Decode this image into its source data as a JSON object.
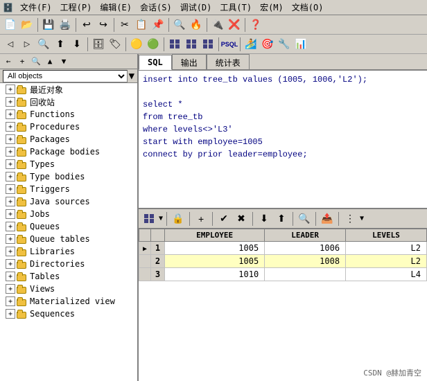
{
  "menubar": {
    "items": [
      {
        "label": "文件(F)"
      },
      {
        "label": "工程(P)"
      },
      {
        "label": "编辑(E)"
      },
      {
        "label": "会话(S)"
      },
      {
        "label": "调试(D)"
      },
      {
        "label": "工具(T)"
      },
      {
        "label": "宏(M)"
      },
      {
        "label": "文档(O)"
      }
    ]
  },
  "left_panel": {
    "nav_items": [
      "←",
      "+",
      "🔍",
      "⬆",
      "⬇"
    ],
    "dropdown_label": "All objects",
    "tree": [
      {
        "label": "最近对象",
        "expanded": false
      },
      {
        "label": "回收站",
        "expanded": false
      },
      {
        "label": "Functions",
        "expanded": false
      },
      {
        "label": "Procedures",
        "expanded": false
      },
      {
        "label": "Packages",
        "expanded": false
      },
      {
        "label": "Package bodies",
        "expanded": false
      },
      {
        "label": "Types",
        "expanded": false
      },
      {
        "label": "Type bodies",
        "expanded": false
      },
      {
        "label": "Triggers",
        "expanded": false
      },
      {
        "label": "Java sources",
        "expanded": false
      },
      {
        "label": "Jobs",
        "expanded": false
      },
      {
        "label": "Queues",
        "expanded": false
      },
      {
        "label": "Queue tables",
        "expanded": false
      },
      {
        "label": "Libraries",
        "expanded": false
      },
      {
        "label": "Directories",
        "expanded": false
      },
      {
        "label": "Tables",
        "expanded": false
      },
      {
        "label": "Views",
        "expanded": false
      },
      {
        "label": "Materialized view",
        "expanded": false
      },
      {
        "label": "Sequences",
        "expanded": false
      }
    ]
  },
  "sql_tabs": [
    {
      "label": "SQL",
      "active": true
    },
    {
      "label": "输出",
      "active": false
    },
    {
      "label": "统计表",
      "active": false
    }
  ],
  "sql_content": {
    "lines": [
      "insert into tree_tb values (1005, 1006,'L2');",
      "",
      "select *",
      "from tree_tb",
      "where levels<>'L3'",
      "start with employee=1005",
      "connect by prior leader=employee;"
    ]
  },
  "data_grid": {
    "columns": [
      "",
      "",
      "EMPLOYEE",
      "LEADER",
      "LEVELS"
    ],
    "rows": [
      {
        "indicator": "▶",
        "num": "1",
        "employee": "1005",
        "leader": "1006",
        "levels": "L2",
        "style": "odd"
      },
      {
        "indicator": "",
        "num": "2",
        "employee": "1005",
        "leader": "1008",
        "levels": "L2",
        "style": "highlight"
      },
      {
        "indicator": "",
        "num": "3",
        "employee": "1010",
        "leader": "",
        "levels": "L4",
        "style": "odd"
      }
    ]
  },
  "watermark": "CSDN @赫加青空"
}
